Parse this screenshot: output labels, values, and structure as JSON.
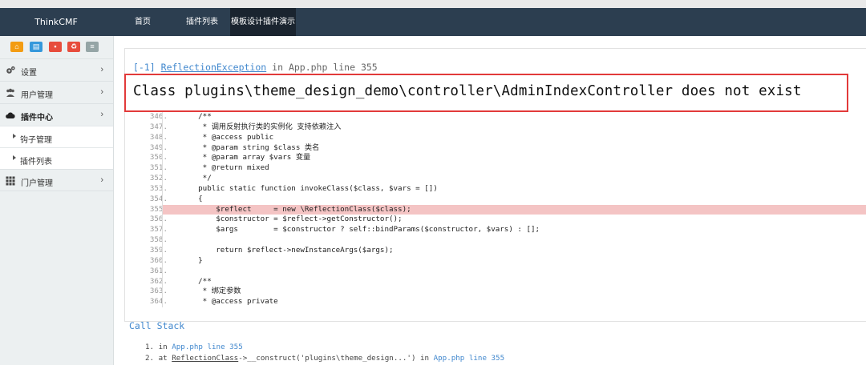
{
  "nav": {
    "brand": "ThinkCMF",
    "items": [
      {
        "label": "首页"
      },
      {
        "label": "插件列表"
      },
      {
        "label": "模板设计插件演示"
      }
    ]
  },
  "sidebar": {
    "menu": [
      {
        "label": "设置",
        "icon": "gears-icon"
      },
      {
        "label": "用户管理",
        "icon": "users-icon"
      },
      {
        "label": "插件中心",
        "icon": "cloud-icon"
      },
      {
        "label": "门户管理",
        "icon": "grid-icon"
      }
    ],
    "sub": [
      {
        "label": "钩子管理"
      },
      {
        "label": "插件列表"
      }
    ]
  },
  "exception": {
    "code": "[-1]",
    "class_name": "ReflectionException",
    "location_in": "in",
    "file": "App.php line 355",
    "message": "Class plugins\\theme_design_demo\\controller\\AdminIndexController does not exist"
  },
  "source": {
    "lines": [
      {
        "n": "346.",
        "t": "    /**"
      },
      {
        "n": "347.",
        "t": "     * 调用反射执行类的实例化 支持依赖注入"
      },
      {
        "n": "348.",
        "t": "     * @access public"
      },
      {
        "n": "349.",
        "t": "     * @param string $class 类名"
      },
      {
        "n": "350.",
        "t": "     * @param array $vars 变量"
      },
      {
        "n": "351.",
        "t": "     * @return mixed"
      },
      {
        "n": "352.",
        "t": "     */"
      },
      {
        "n": "353.",
        "t": "    public static function invokeClass($class, $vars = [])"
      },
      {
        "n": "354.",
        "t": "    {"
      },
      {
        "n": "355.",
        "t": "        $reflect     = new \\ReflectionClass($class);"
      },
      {
        "n": "356.",
        "t": "        $constructor = $reflect->getConstructor();"
      },
      {
        "n": "357.",
        "t": "        $args        = $constructor ? self::bindParams($constructor, $vars) : [];"
      },
      {
        "n": "358.",
        "t": ""
      },
      {
        "n": "359.",
        "t": "        return $reflect->newInstanceArgs($args);"
      },
      {
        "n": "360.",
        "t": "    }"
      },
      {
        "n": "361.",
        "t": ""
      },
      {
        "n": "362.",
        "t": "    /**"
      },
      {
        "n": "363.",
        "t": "     * 绑定参数"
      },
      {
        "n": "364.",
        "t": "     * @access private"
      }
    ]
  },
  "call_stack": {
    "title": "Call Stack",
    "rows": [
      {
        "n": "1.",
        "pre": "in ",
        "file": "App.php line 355",
        "cls": "",
        "mid": ""
      },
      {
        "n": "2.",
        "pre": "at ",
        "cls": "ReflectionClass",
        "mid": "->__construct('plugins\\theme_design...') in ",
        "file": "App.php line 355"
      }
    ]
  },
  "colors": {
    "navbar": "#2c3e50",
    "sidebar": "#ecf0f1",
    "accent_blue": "#4288ce",
    "error_border": "#e23a3a",
    "highlight_line": "#f4c4c4",
    "shortcut_colors": [
      "#f39c12",
      "#3498db",
      "#e74c3c",
      "#e74c3c",
      "#95a5a6"
    ]
  }
}
